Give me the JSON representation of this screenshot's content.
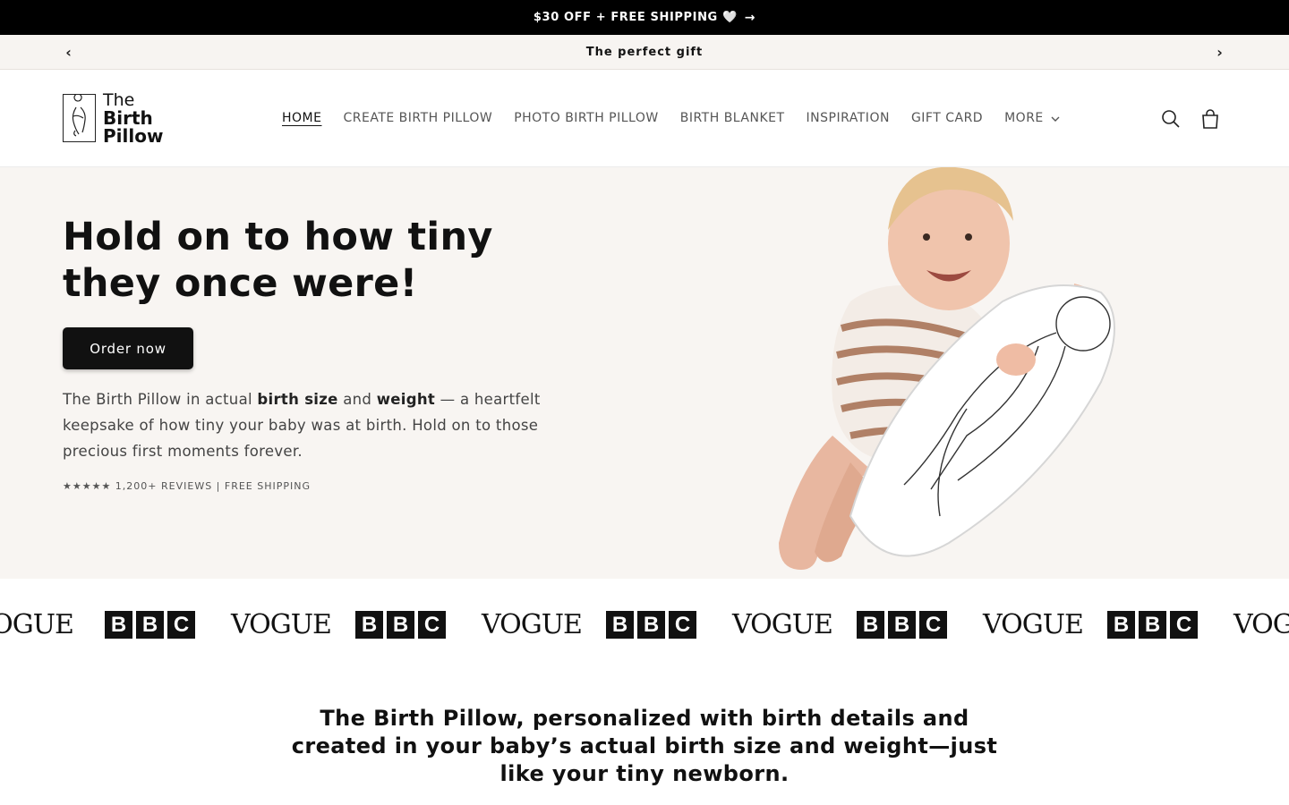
{
  "promo": {
    "text": "$30 OFF + FREE SHIPPING 🤍",
    "arrow": "→"
  },
  "announcement": {
    "text": "The perfect gift",
    "prev": "‹",
    "next": "›"
  },
  "header": {
    "logo_line1": "The",
    "logo_line2": "Birth Pillow",
    "nav": [
      {
        "label": "HOME",
        "active": true
      },
      {
        "label": "CREATE BIRTH PILLOW"
      },
      {
        "label": "PHOTO BIRTH PILLOW"
      },
      {
        "label": "BIRTH BLANKET"
      },
      {
        "label": "INSPIRATION"
      },
      {
        "label": "GIFT CARD"
      },
      {
        "label": "MORE"
      }
    ],
    "icons": [
      "search-icon",
      "cart-icon"
    ]
  },
  "hero": {
    "title": "Hold on to how tiny they once were!",
    "cta": "Order now",
    "desc_1": "The Birth Pillow in actual ",
    "desc_bold_1": "birth size",
    "desc_2": " and ",
    "desc_bold_2": "weight",
    "desc_3": " — a heartfelt keepsake of how tiny your baby was at birth. Hold on to those precious first moments forever.",
    "meta": "★★★★★ 1,200+ REVIEWS | FREE SHIPPING"
  },
  "press": {
    "vogue": "VOGUE",
    "bbc": [
      "B",
      "B",
      "C"
    ]
  },
  "tagline": "The Birth Pillow, personalized with birth details and created in your baby’s actual birth size and weight—just like your tiny newborn.",
  "colors": {
    "promo_bg": "#000000",
    "hero_bg": "#f8f5f2",
    "button_bg": "#111111"
  }
}
